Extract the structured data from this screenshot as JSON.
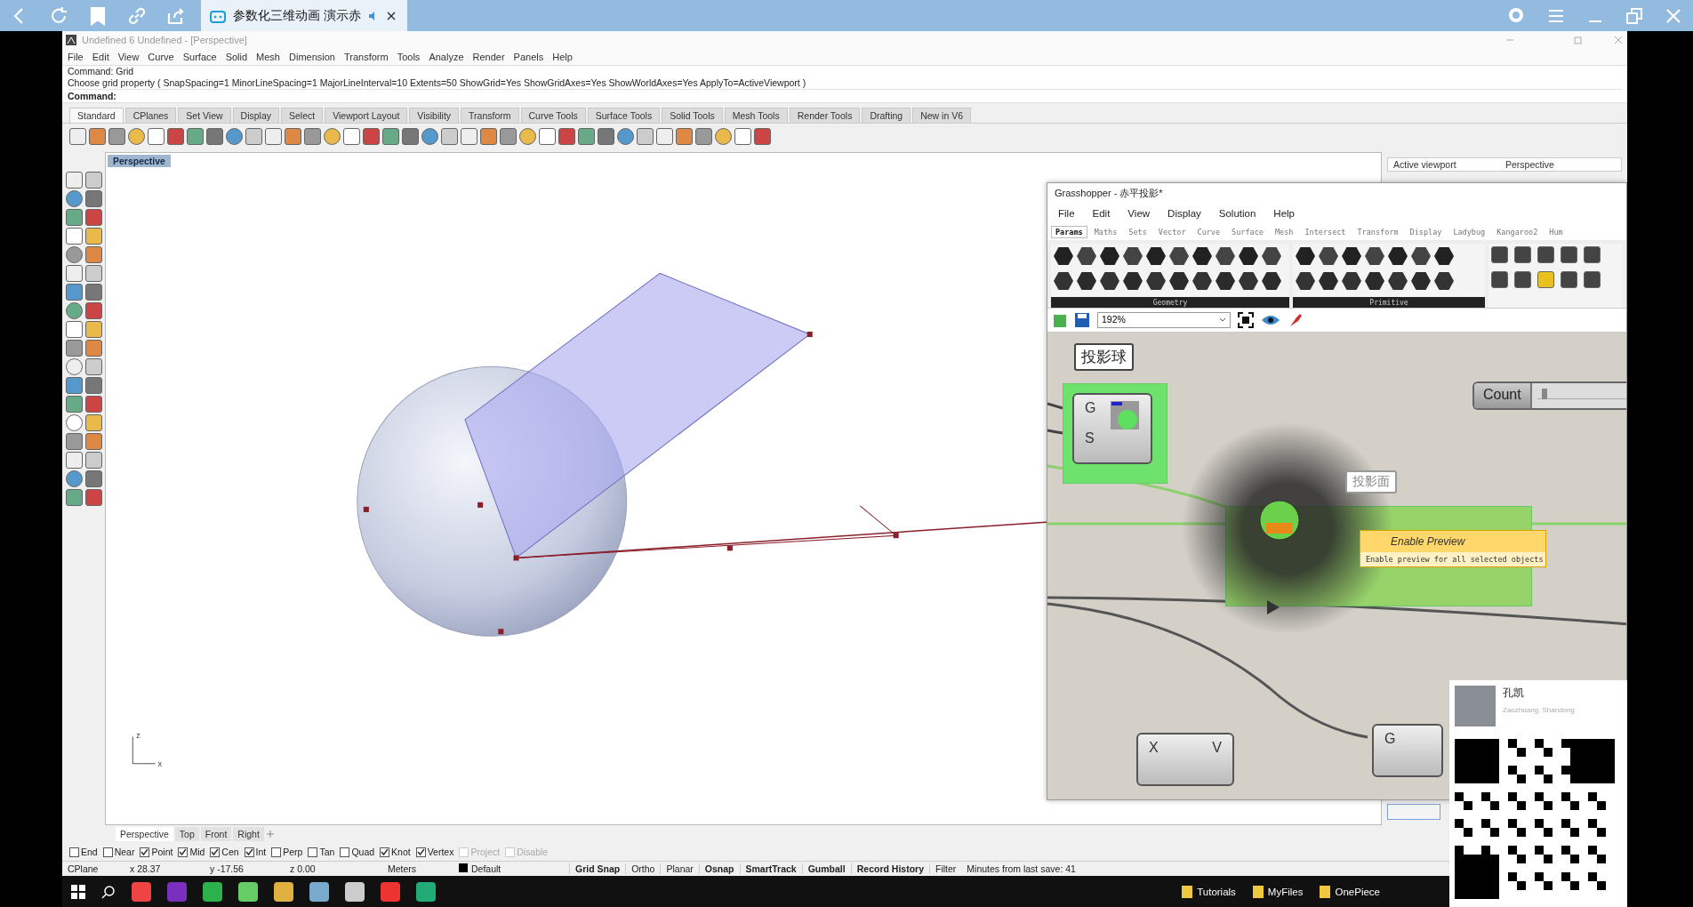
{
  "browser": {
    "tab_title": "参数化三维动画 演示赤"
  },
  "rhino": {
    "title": "Undefined 6 Undefined - [Perspective]",
    "menu": [
      "File",
      "Edit",
      "View",
      "Curve",
      "Surface",
      "Solid",
      "Mesh",
      "Dimension",
      "Transform",
      "Tools",
      "Analyze",
      "Render",
      "Panels",
      "Help"
    ],
    "command_history": [
      "Command: Grid",
      "Choose grid property ( SnapSpacing=1  MinorLineSpacing=1  MajorLineInterval=10  Extents=50  ShowGrid=Yes  ShowGridAxes=Yes  ShowWorldAxes=Yes  ApplyTo=ActiveViewport )"
    ],
    "command_prompt": "Command:",
    "toolbar_tabs": [
      {
        "label": "Standard",
        "selected": true
      },
      {
        "label": "CPlanes",
        "selected": false
      },
      {
        "label": "Set View",
        "selected": false
      },
      {
        "label": "Display",
        "selected": false
      },
      {
        "label": "Select",
        "selected": false
      },
      {
        "label": "Viewport Layout",
        "selected": false
      },
      {
        "label": "Visibility",
        "selected": false
      },
      {
        "label": "Transform",
        "selected": false
      },
      {
        "label": "Curve Tools",
        "selected": false
      },
      {
        "label": "Surface Tools",
        "selected": false
      },
      {
        "label": "Solid Tools",
        "selected": false
      },
      {
        "label": "Mesh Tools",
        "selected": false
      },
      {
        "label": "Render Tools",
        "selected": false
      },
      {
        "label": "Drafting",
        "selected": false
      },
      {
        "label": "New in V6",
        "selected": false
      }
    ],
    "viewport_label": "Perspective",
    "axis_labels": [
      "z",
      "x"
    ],
    "panel": {
      "label": "Active viewport",
      "value": "Perspective"
    },
    "viewport_tabs": [
      {
        "label": "Perspective",
        "selected": true
      },
      {
        "label": "Top",
        "selected": false
      },
      {
        "label": "Front",
        "selected": false
      },
      {
        "label": "Right",
        "selected": false
      }
    ],
    "osnaps": [
      {
        "label": "End",
        "checked": false,
        "disabled": false
      },
      {
        "label": "Near",
        "checked": false,
        "disabled": false
      },
      {
        "label": "Point",
        "checked": true,
        "disabled": false
      },
      {
        "label": "Mid",
        "checked": true,
        "disabled": false
      },
      {
        "label": "Cen",
        "checked": true,
        "disabled": false
      },
      {
        "label": "Int",
        "checked": true,
        "disabled": false
      },
      {
        "label": "Perp",
        "checked": false,
        "disabled": false
      },
      {
        "label": "Tan",
        "checked": false,
        "disabled": false
      },
      {
        "label": "Quad",
        "checked": false,
        "disabled": false
      },
      {
        "label": "Knot",
        "checked": true,
        "disabled": false
      },
      {
        "label": "Vertex",
        "checked": true,
        "disabled": false
      },
      {
        "label": "Project",
        "checked": false,
        "disabled": true
      },
      {
        "label": "Disable",
        "checked": false,
        "disabled": true
      }
    ],
    "status": {
      "cplane": "CPlane",
      "x": "x 28.37",
      "y": "y -17.56",
      "z": "z 0.00",
      "units": "Meters",
      "layer": "Default",
      "toggles": [
        {
          "label": "Grid Snap",
          "on": true
        },
        {
          "label": "Ortho",
          "on": false
        },
        {
          "label": "Planar",
          "on": false
        },
        {
          "label": "Osnap",
          "on": true
        },
        {
          "label": "SmartTrack",
          "on": true
        },
        {
          "label": "Gumball",
          "on": true
        },
        {
          "label": "Record History",
          "on": true
        },
        {
          "label": "Filter",
          "on": false
        }
      ],
      "save_info": "Minutes from last save: 41"
    }
  },
  "grasshopper": {
    "title": "Grasshopper - 赤平投影*",
    "menu": [
      "File",
      "Edit",
      "View",
      "Display",
      "Solution",
      "Help"
    ],
    "tabs": [
      {
        "label": "Params",
        "selected": true
      },
      {
        "label": "Maths",
        "selected": false
      },
      {
        "label": "Sets",
        "selected": false
      },
      {
        "label": "Vector",
        "selected": false
      },
      {
        "label": "Curve",
        "selected": false
      },
      {
        "label": "Surface",
        "selected": false
      },
      {
        "label": "Mesh",
        "selected": false
      },
      {
        "label": "Intersect",
        "selected": false
      },
      {
        "label": "Transform",
        "selected": false
      },
      {
        "label": "Display",
        "selected": false
      },
      {
        "label": "Ladybug",
        "selected": false
      },
      {
        "label": "Kangaroo2",
        "selected": false
      },
      {
        "label": "Hum",
        "selected": false
      }
    ],
    "panel_groups": [
      "Geometry",
      "Primitive"
    ],
    "zoom": "192%",
    "sphere_group": {
      "bubble": "投影球",
      "inputs": [
        "G",
        "S"
      ]
    },
    "slider": {
      "label": "Count",
      "level": 0.05
    },
    "plane_bubble": "投影面",
    "tooltip": {
      "title": "Enable Preview",
      "description": "Enable preview for all selected objects"
    },
    "lower_nodes": [
      {
        "inputs": [
          "X"
        ],
        "outputs": [
          "V"
        ]
      },
      {
        "inputs": [
          "G"
        ]
      }
    ]
  },
  "taskbar": {
    "folders": [
      "Tutorials",
      "MyFiles",
      "OnePiece"
    ]
  },
  "profile": {
    "name": "孔凯",
    "location": "Zaozhuang, Shandong"
  }
}
